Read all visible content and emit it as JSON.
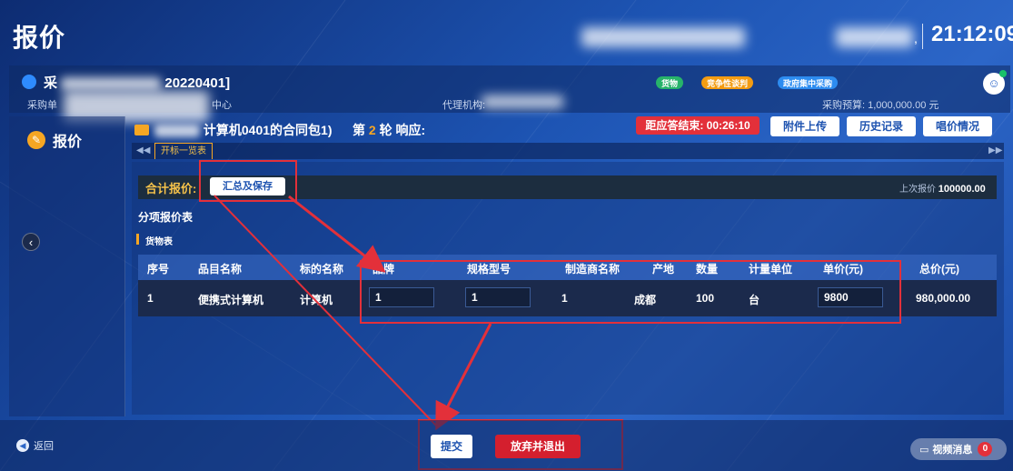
{
  "header": {
    "title": "报价",
    "clock_suffix": ",",
    "clock": "21:12:09"
  },
  "project": {
    "title": "采购计划编号 [20220401]",
    "title_visible_prefix": "采",
    "title_visible_suffix": "20220401]",
    "purchaser_label": "采购单",
    "center_suffix": "中心",
    "agency_label": "代理机构:",
    "budget": "采购预算: 1,000,000.00 元",
    "tags": [
      {
        "label": "货物",
        "color": "#27b36a"
      },
      {
        "label": "竞争性谈判",
        "color": "#f39c12"
      },
      {
        "label": "政府集中采购",
        "color": "#2d8cf0"
      }
    ]
  },
  "sidebar": {
    "item_label": "报价"
  },
  "package": {
    "title": "包1(采购计算机0401的合同包1)",
    "title_visible": "计算机0401的合同包1)",
    "round_prefix": "第",
    "round_num": "2",
    "round_suffix": "轮 响应:",
    "countdown": "距应答结束: 00:26:10",
    "buttons": {
      "upload": "附件上传",
      "history": "历史记录",
      "price_status": "唱价情况"
    }
  },
  "tabs": {
    "left_arrow": "◀◀",
    "right_arrow": "▶▶",
    "active": "开标一览表"
  },
  "quote": {
    "total_label": "合计报价:",
    "summary_button": "汇总及保存",
    "last_bid_label": "上次报价",
    "last_bid_value": "100000.00",
    "subtable_title": "分项报价表",
    "goods_label": "货物表"
  },
  "table": {
    "headers": [
      "序号",
      "品目名称",
      "标的名称",
      "品牌",
      "规格型号",
      "制造商名称",
      "产地",
      "数量",
      "计量单位",
      "单价(元)",
      "总价(元)"
    ],
    "row": {
      "index": "1",
      "category": "便携式计算机",
      "item": "计算机",
      "brand": "1",
      "model": "1",
      "manufacturer": "1",
      "origin": "成都",
      "quantity": "100",
      "unit": "台",
      "unit_price": "9800",
      "total_price": "980,000.00"
    }
  },
  "footer": {
    "back": "返回",
    "submit": "提交",
    "abandon": "放弃并退出",
    "video_msg": "视频消息",
    "video_count": "0"
  },
  "colors": {
    "accent_red": "#e3303a",
    "accent_orange": "#f6a623",
    "brand_blue": "#2c66c8"
  }
}
